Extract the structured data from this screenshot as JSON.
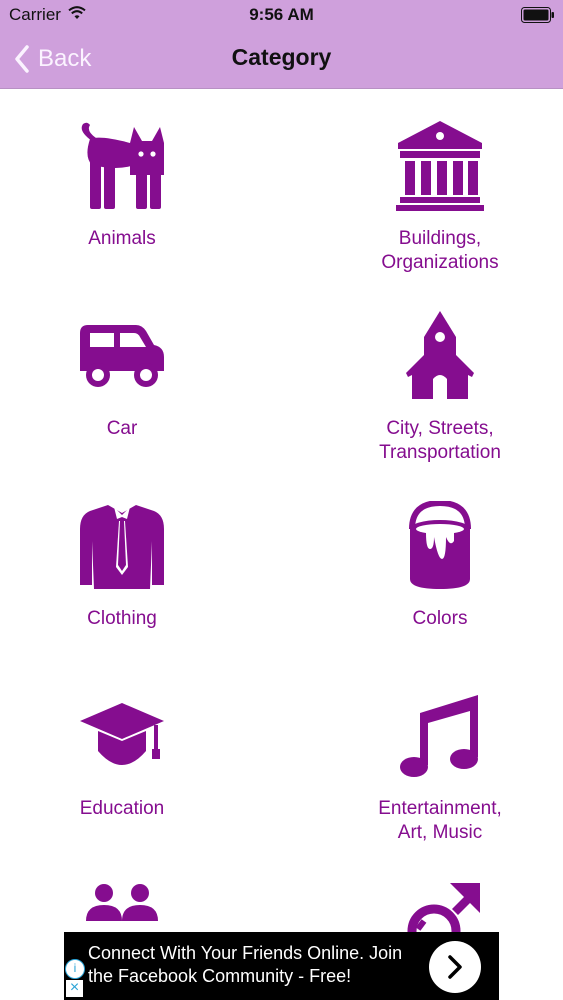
{
  "status_bar": {
    "carrier": "Carrier",
    "time": "9:56 AM"
  },
  "nav": {
    "back_label": "Back",
    "title": "Category"
  },
  "categories": [
    {
      "label": "Animals",
      "icon": "cat-icon"
    },
    {
      "label": "Buildings,\nOrganizations",
      "icon": "building-icon"
    },
    {
      "label": "Car",
      "icon": "car-icon"
    },
    {
      "label": "City, Streets,\nTransportation",
      "icon": "church-icon"
    },
    {
      "label": "Clothing",
      "icon": "jacket-icon"
    },
    {
      "label": "Colors",
      "icon": "paint-bucket-icon"
    },
    {
      "label": "Education",
      "icon": "graduation-cap-icon"
    },
    {
      "label": "Entertainment,\nArt, Music",
      "icon": "music-note-icon"
    },
    {
      "label": "",
      "icon": "people-icon"
    },
    {
      "label": "",
      "icon": "gender-icon"
    }
  ],
  "ad": {
    "text": "Connect With Your Friends Online. Join the Facebook Community - Free!",
    "info_glyph": "i",
    "close_glyph": "×"
  },
  "colors": {
    "bar": "#cfa0dc",
    "accent": "#850d8f"
  }
}
